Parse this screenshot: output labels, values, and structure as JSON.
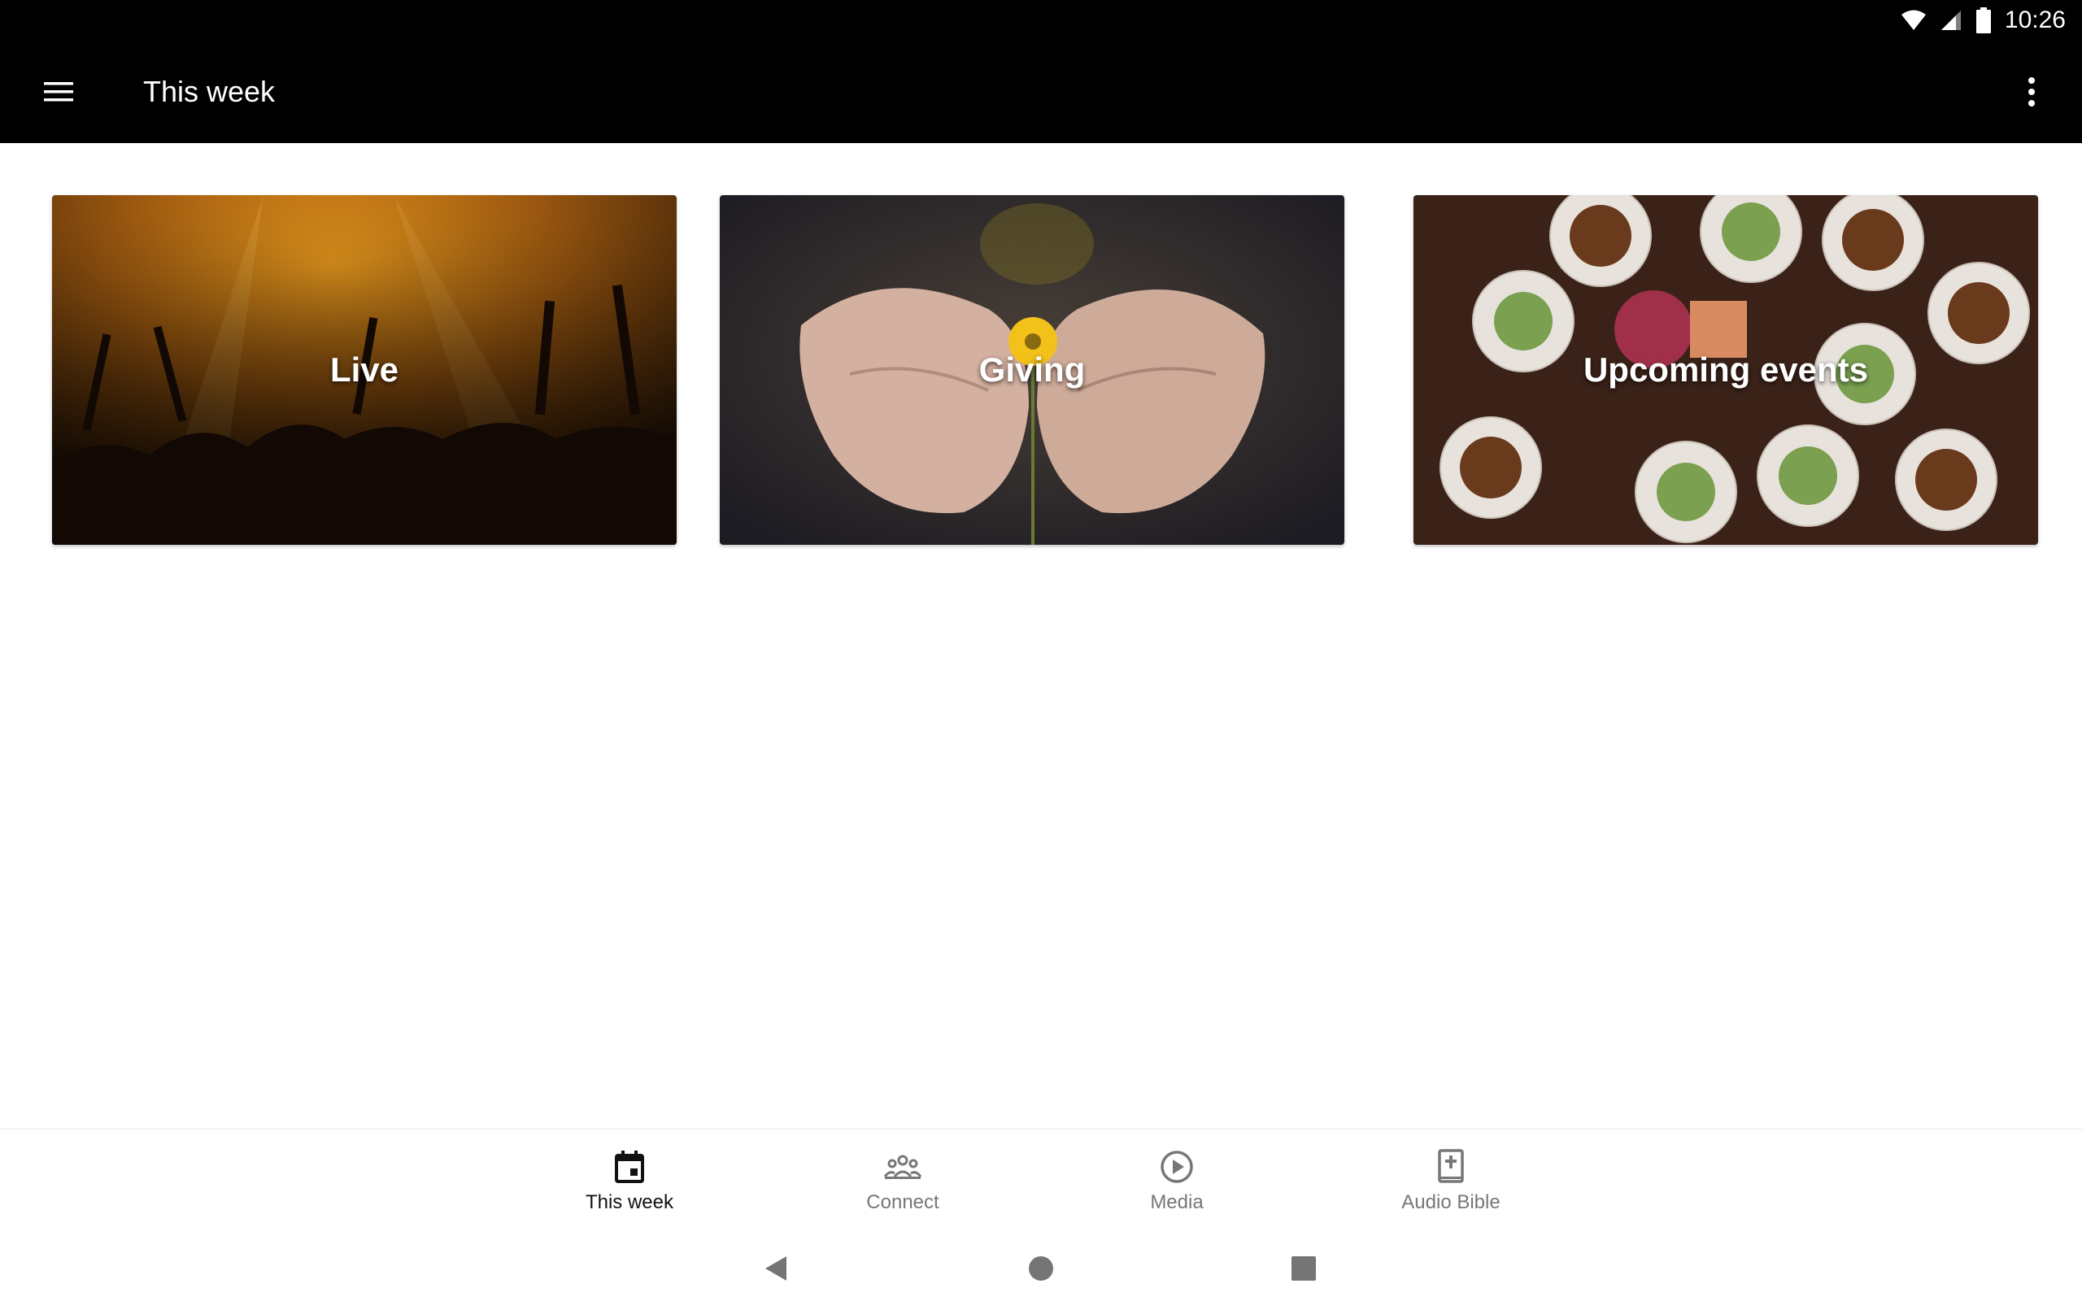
{
  "status_bar": {
    "time": "10:26",
    "icons": [
      "wifi-icon",
      "cell-signal-icon",
      "battery-icon"
    ]
  },
  "app_bar": {
    "title": "This week",
    "left_icon": "menu-icon",
    "right_icon": "overflow-menu-icon"
  },
  "cards": [
    {
      "label": "Live"
    },
    {
      "label": "Giving"
    },
    {
      "label": "Upcoming events"
    }
  ],
  "bottom_nav": {
    "items": [
      {
        "label": "This week",
        "icon": "calendar-icon",
        "active": true
      },
      {
        "label": "Connect",
        "icon": "group-icon",
        "active": false
      },
      {
        "label": "Media",
        "icon": "play-circle-icon",
        "active": false
      },
      {
        "label": "Audio Bible",
        "icon": "bible-icon",
        "active": false
      }
    ]
  },
  "system_nav": {
    "buttons": [
      "back-icon",
      "home-icon",
      "recents-icon"
    ]
  },
  "colors": {
    "app_bar": "#000000",
    "background": "#ffffff",
    "nav_active": "#111111",
    "nav_inactive": "#777777"
  }
}
